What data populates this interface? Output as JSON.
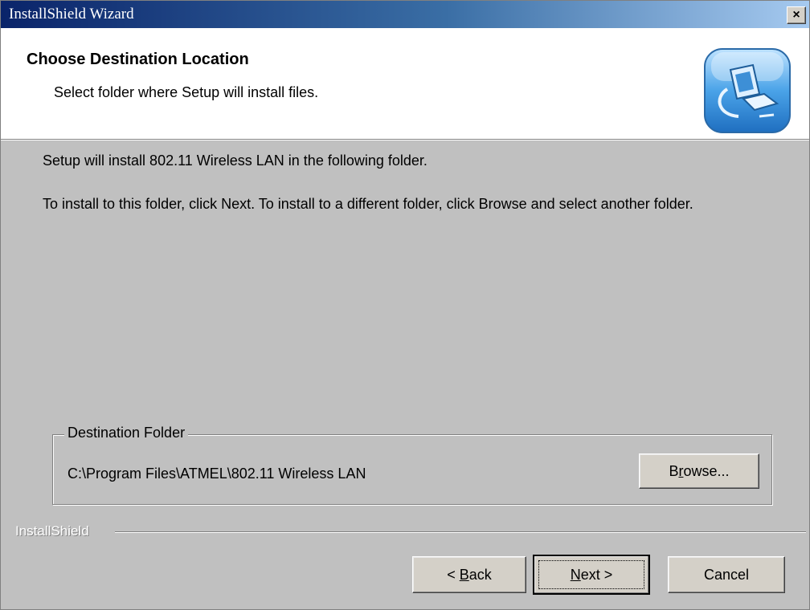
{
  "window": {
    "title": "InstallShield Wizard",
    "close_glyph": "×"
  },
  "header": {
    "title": "Choose Destination Location",
    "subtitle": "Select folder where Setup will install files.",
    "icon": "computer-setup-icon"
  },
  "body": {
    "line1": "Setup will install 802.11 Wireless LAN in the following folder.",
    "line2": "To install to this folder, click Next. To install to a different folder, click Browse and select another folder."
  },
  "destination": {
    "legend": "Destination Folder",
    "path": "C:\\Program Files\\ATMEL\\802.11 Wireless LAN",
    "browse_pre": "B",
    "browse_key": "r",
    "browse_post": "owse..."
  },
  "footer": {
    "brand": "InstallShield",
    "back_pre": "< ",
    "back_key": "B",
    "back_post": "ack",
    "next_key": "N",
    "next_post": "ext >",
    "cancel_label": "Cancel"
  }
}
